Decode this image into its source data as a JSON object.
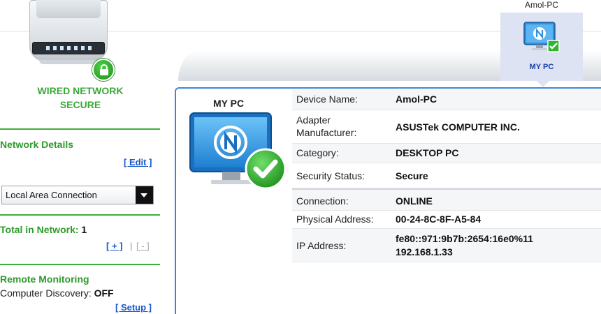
{
  "router": {
    "status_line1": "WIRED NETWORK",
    "status_line2": "SECURE"
  },
  "sidebar": {
    "network_details": {
      "title": "Network Details",
      "edit_link": "[ Edit ]"
    },
    "connection_select": {
      "value": "Local Area Connection"
    },
    "total": {
      "label": "Total in Network:",
      "value": "1",
      "add_link": "[ + ]",
      "separator": "|",
      "remove_link": "[ - ]"
    },
    "remote": {
      "title": "Remote Monitoring",
      "discovery_label": "Computer Discovery:",
      "discovery_value": "OFF",
      "setup_link": "[ Setup ]"
    }
  },
  "device_tab": {
    "host_label": "Amol-PC",
    "name": "MY PC"
  },
  "panel": {
    "title": "MY PC",
    "rows": [
      {
        "label": "Device Name:",
        "value": "Amol-PC"
      },
      {
        "label": "Adapter Manufacturer:",
        "value": "ASUSTek COMPUTER INC."
      },
      {
        "label": "Category:",
        "value": "DESKTOP PC"
      },
      {
        "label": "Security Status:",
        "value": "Secure"
      },
      {
        "label": "Connection:",
        "value": "ONLINE"
      },
      {
        "label": "Physical Address:",
        "value": "00-24-8C-8F-A5-84"
      },
      {
        "label": "IP Address:",
        "value": "fe80::971:9b7b:2654:16e0%11\n192.168.1.33"
      }
    ]
  },
  "colors": {
    "accent_green": "#39a837",
    "link_blue": "#1b57c8",
    "panel_border": "#3f86d9",
    "tab_bg": "#dde3f2"
  },
  "icons": [
    "router-icon",
    "lock-icon",
    "monitor-icon",
    "check-icon",
    "dropdown-arrow-icon"
  ]
}
